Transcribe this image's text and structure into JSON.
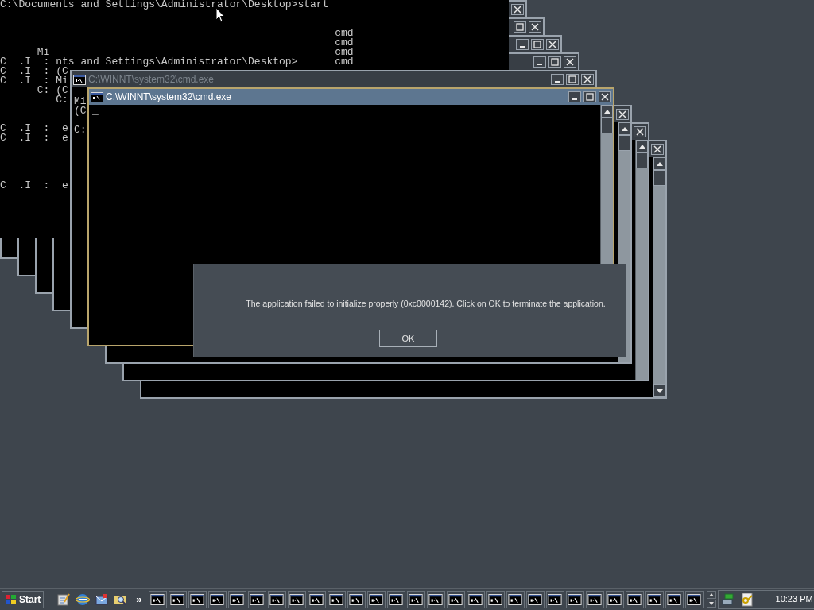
{
  "console": {
    "lines": [
      "C:\\Documents and Settings\\Administrator\\Desktop>start",
      "cmd",
      "cmd",
      "Mi",
      "cmd",
      "C  .I  :",
      "nts and Settings\\Administrator\\Desktop>",
      "cmd",
      "C  .I  :",
      "(C",
      "C  .I  :",
      "Mi",
      "C:",
      "(C",
      "C:",
      "C  .I  :  e",
      "C  .I  :  e",
      "C  .I  :  e"
    ]
  },
  "windows": [
    {
      "kind": "console",
      "active": false
    },
    {
      "kind": "console",
      "active": false
    },
    {
      "kind": "console",
      "active": false
    },
    {
      "kind": "console",
      "active": false
    },
    {
      "kind": "console",
      "title": "C:\\WINNT\\system32\\cmd.exe",
      "active": false,
      "lines": [
        "Mi",
        "(C",
        "C:"
      ]
    },
    {
      "kind": "console",
      "title": "C:\\WINNT\\system32\\cmd.exe",
      "active": true,
      "cursor": "_"
    },
    {
      "kind": "console"
    },
    {
      "kind": "console"
    },
    {
      "kind": "console"
    }
  ],
  "dialog": {
    "message": "The application failed to initialize properly (0xc0000142). Click on OK to terminate the application.",
    "button": "OK"
  },
  "taskbar": {
    "start": "Start",
    "chevron": "»",
    "tasks": [
      {
        "selected": false
      },
      {
        "selected": false
      },
      {
        "selected": false
      },
      {
        "selected": false
      },
      {
        "selected": false
      },
      {
        "selected": false
      },
      {
        "selected": false
      },
      {
        "selected": false
      },
      {
        "selected": false
      },
      {
        "selected": false
      },
      {
        "selected": false
      },
      {
        "selected": false
      },
      {
        "selected": false
      },
      {
        "selected": false
      },
      {
        "selected": false
      },
      {
        "selected": false
      },
      {
        "selected": false
      },
      {
        "selected": false
      },
      {
        "selected": false
      },
      {
        "selected": false
      },
      {
        "selected": false
      },
      {
        "selected": false
      },
      {
        "selected": false
      },
      {
        "selected": false
      },
      {
        "selected": false
      },
      {
        "selected": false
      },
      {
        "selected": false
      },
      {
        "selected": false
      }
    ],
    "clock": "10:23 PM"
  }
}
